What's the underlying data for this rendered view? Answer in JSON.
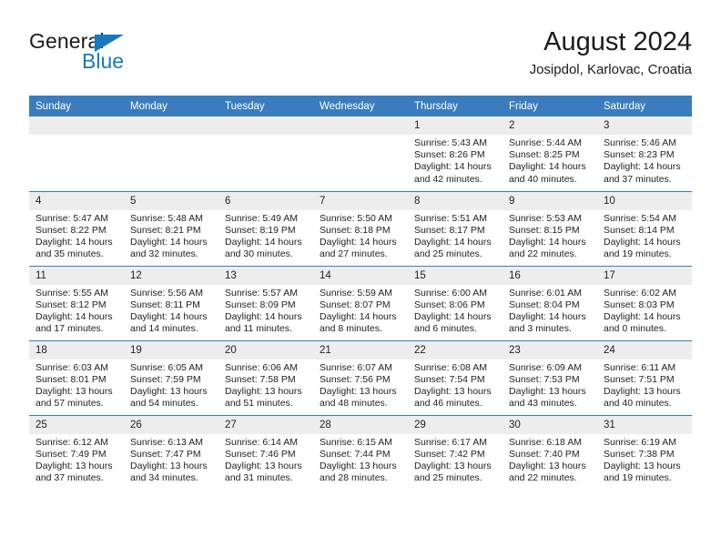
{
  "brand": {
    "word1": "General",
    "word2": "Blue",
    "accent_color": "#1878be"
  },
  "header": {
    "title": "August 2024",
    "subtitle": "Josipdol, Karlovac, Croatia"
  },
  "calendar": {
    "header_bg": "#3a7cbe",
    "daynum_bg": "#ededed",
    "weekday_headers": [
      "Sunday",
      "Monday",
      "Tuesday",
      "Wednesday",
      "Thursday",
      "Friday",
      "Saturday"
    ],
    "weeks": [
      [
        {
          "day": "",
          "empty": true
        },
        {
          "day": "",
          "empty": true
        },
        {
          "day": "",
          "empty": true
        },
        {
          "day": "",
          "empty": true
        },
        {
          "day": "1",
          "sunrise": "Sunrise: 5:43 AM",
          "sunset": "Sunset: 8:26 PM",
          "daylight_1": "Daylight: 14 hours",
          "daylight_2": "and 42 minutes."
        },
        {
          "day": "2",
          "sunrise": "Sunrise: 5:44 AM",
          "sunset": "Sunset: 8:25 PM",
          "daylight_1": "Daylight: 14 hours",
          "daylight_2": "and 40 minutes."
        },
        {
          "day": "3",
          "sunrise": "Sunrise: 5:46 AM",
          "sunset": "Sunset: 8:23 PM",
          "daylight_1": "Daylight: 14 hours",
          "daylight_2": "and 37 minutes."
        }
      ],
      [
        {
          "day": "4",
          "sunrise": "Sunrise: 5:47 AM",
          "sunset": "Sunset: 8:22 PM",
          "daylight_1": "Daylight: 14 hours",
          "daylight_2": "and 35 minutes."
        },
        {
          "day": "5",
          "sunrise": "Sunrise: 5:48 AM",
          "sunset": "Sunset: 8:21 PM",
          "daylight_1": "Daylight: 14 hours",
          "daylight_2": "and 32 minutes."
        },
        {
          "day": "6",
          "sunrise": "Sunrise: 5:49 AM",
          "sunset": "Sunset: 8:19 PM",
          "daylight_1": "Daylight: 14 hours",
          "daylight_2": "and 30 minutes."
        },
        {
          "day": "7",
          "sunrise": "Sunrise: 5:50 AM",
          "sunset": "Sunset: 8:18 PM",
          "daylight_1": "Daylight: 14 hours",
          "daylight_2": "and 27 minutes."
        },
        {
          "day": "8",
          "sunrise": "Sunrise: 5:51 AM",
          "sunset": "Sunset: 8:17 PM",
          "daylight_1": "Daylight: 14 hours",
          "daylight_2": "and 25 minutes."
        },
        {
          "day": "9",
          "sunrise": "Sunrise: 5:53 AM",
          "sunset": "Sunset: 8:15 PM",
          "daylight_1": "Daylight: 14 hours",
          "daylight_2": "and 22 minutes."
        },
        {
          "day": "10",
          "sunrise": "Sunrise: 5:54 AM",
          "sunset": "Sunset: 8:14 PM",
          "daylight_1": "Daylight: 14 hours",
          "daylight_2": "and 19 minutes."
        }
      ],
      [
        {
          "day": "11",
          "sunrise": "Sunrise: 5:55 AM",
          "sunset": "Sunset: 8:12 PM",
          "daylight_1": "Daylight: 14 hours",
          "daylight_2": "and 17 minutes."
        },
        {
          "day": "12",
          "sunrise": "Sunrise: 5:56 AM",
          "sunset": "Sunset: 8:11 PM",
          "daylight_1": "Daylight: 14 hours",
          "daylight_2": "and 14 minutes."
        },
        {
          "day": "13",
          "sunrise": "Sunrise: 5:57 AM",
          "sunset": "Sunset: 8:09 PM",
          "daylight_1": "Daylight: 14 hours",
          "daylight_2": "and 11 minutes."
        },
        {
          "day": "14",
          "sunrise": "Sunrise: 5:59 AM",
          "sunset": "Sunset: 8:07 PM",
          "daylight_1": "Daylight: 14 hours",
          "daylight_2": "and 8 minutes."
        },
        {
          "day": "15",
          "sunrise": "Sunrise: 6:00 AM",
          "sunset": "Sunset: 8:06 PM",
          "daylight_1": "Daylight: 14 hours",
          "daylight_2": "and 6 minutes."
        },
        {
          "day": "16",
          "sunrise": "Sunrise: 6:01 AM",
          "sunset": "Sunset: 8:04 PM",
          "daylight_1": "Daylight: 14 hours",
          "daylight_2": "and 3 minutes."
        },
        {
          "day": "17",
          "sunrise": "Sunrise: 6:02 AM",
          "sunset": "Sunset: 8:03 PM",
          "daylight_1": "Daylight: 14 hours",
          "daylight_2": "and 0 minutes."
        }
      ],
      [
        {
          "day": "18",
          "sunrise": "Sunrise: 6:03 AM",
          "sunset": "Sunset: 8:01 PM",
          "daylight_1": "Daylight: 13 hours",
          "daylight_2": "and 57 minutes."
        },
        {
          "day": "19",
          "sunrise": "Sunrise: 6:05 AM",
          "sunset": "Sunset: 7:59 PM",
          "daylight_1": "Daylight: 13 hours",
          "daylight_2": "and 54 minutes."
        },
        {
          "day": "20",
          "sunrise": "Sunrise: 6:06 AM",
          "sunset": "Sunset: 7:58 PM",
          "daylight_1": "Daylight: 13 hours",
          "daylight_2": "and 51 minutes."
        },
        {
          "day": "21",
          "sunrise": "Sunrise: 6:07 AM",
          "sunset": "Sunset: 7:56 PM",
          "daylight_1": "Daylight: 13 hours",
          "daylight_2": "and 48 minutes."
        },
        {
          "day": "22",
          "sunrise": "Sunrise: 6:08 AM",
          "sunset": "Sunset: 7:54 PM",
          "daylight_1": "Daylight: 13 hours",
          "daylight_2": "and 46 minutes."
        },
        {
          "day": "23",
          "sunrise": "Sunrise: 6:09 AM",
          "sunset": "Sunset: 7:53 PM",
          "daylight_1": "Daylight: 13 hours",
          "daylight_2": "and 43 minutes."
        },
        {
          "day": "24",
          "sunrise": "Sunrise: 6:11 AM",
          "sunset": "Sunset: 7:51 PM",
          "daylight_1": "Daylight: 13 hours",
          "daylight_2": "and 40 minutes."
        }
      ],
      [
        {
          "day": "25",
          "sunrise": "Sunrise: 6:12 AM",
          "sunset": "Sunset: 7:49 PM",
          "daylight_1": "Daylight: 13 hours",
          "daylight_2": "and 37 minutes."
        },
        {
          "day": "26",
          "sunrise": "Sunrise: 6:13 AM",
          "sunset": "Sunset: 7:47 PM",
          "daylight_1": "Daylight: 13 hours",
          "daylight_2": "and 34 minutes."
        },
        {
          "day": "27",
          "sunrise": "Sunrise: 6:14 AM",
          "sunset": "Sunset: 7:46 PM",
          "daylight_1": "Daylight: 13 hours",
          "daylight_2": "and 31 minutes."
        },
        {
          "day": "28",
          "sunrise": "Sunrise: 6:15 AM",
          "sunset": "Sunset: 7:44 PM",
          "daylight_1": "Daylight: 13 hours",
          "daylight_2": "and 28 minutes."
        },
        {
          "day": "29",
          "sunrise": "Sunrise: 6:17 AM",
          "sunset": "Sunset: 7:42 PM",
          "daylight_1": "Daylight: 13 hours",
          "daylight_2": "and 25 minutes."
        },
        {
          "day": "30",
          "sunrise": "Sunrise: 6:18 AM",
          "sunset": "Sunset: 7:40 PM",
          "daylight_1": "Daylight: 13 hours",
          "daylight_2": "and 22 minutes."
        },
        {
          "day": "31",
          "sunrise": "Sunrise: 6:19 AM",
          "sunset": "Sunset: 7:38 PM",
          "daylight_1": "Daylight: 13 hours",
          "daylight_2": "and 19 minutes."
        }
      ]
    ]
  }
}
